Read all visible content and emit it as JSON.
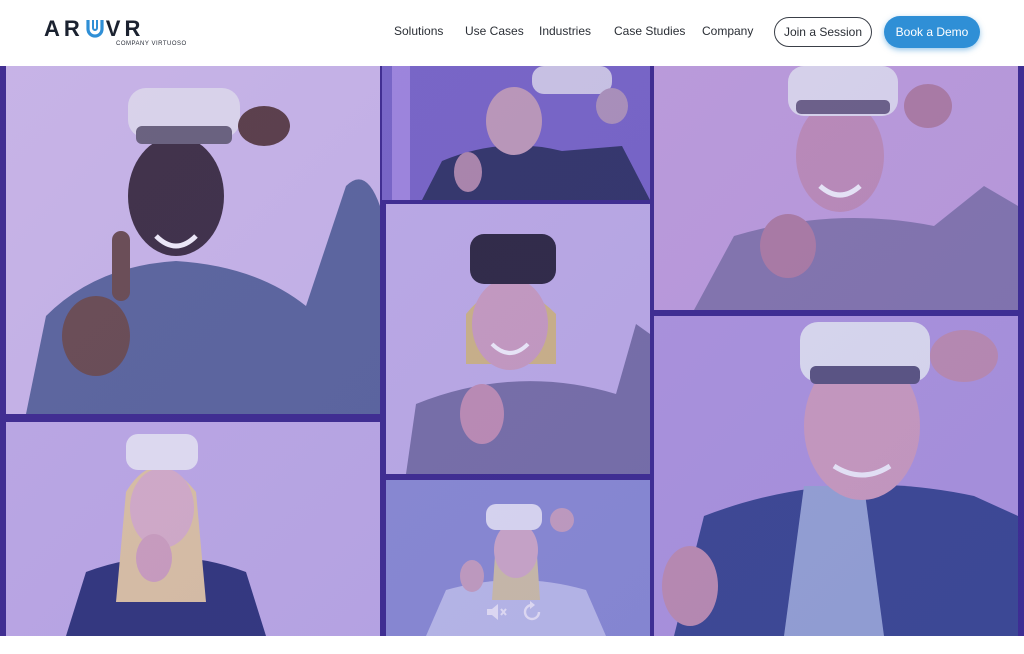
{
  "brand": {
    "logo_left": "AR",
    "logo_right": "VR",
    "logo_tagline": "COMPANY VIRTUOSO"
  },
  "nav": {
    "items": [
      {
        "label": "Solutions"
      },
      {
        "label": "Use Cases"
      },
      {
        "label": "Industries"
      },
      {
        "label": "Case Studies"
      },
      {
        "label": "Company"
      }
    ],
    "join_label": "Join a Session",
    "demo_label": "Book a Demo"
  },
  "colors": {
    "primary_button": "#2f8fd6",
    "hero_overlay": "#6b3fb5",
    "grid_border": "#3b2a8a"
  },
  "hero": {
    "tiles": [
      {
        "name": "man-in-blue-sweater-thumbs-up"
      },
      {
        "name": "bald-man-in-suit-thumbs-up"
      },
      {
        "name": "smiling-man-thumbs-up"
      },
      {
        "name": "woman-in-grey-sweater-thumbs-up"
      },
      {
        "name": "older-man-in-blazer-thumbs-up"
      },
      {
        "name": "blonde-woman-in-navy-blazer-thumbs-up"
      },
      {
        "name": "woman-in-white-shirt-thumbs-up"
      }
    ],
    "video_controls": [
      "mute-icon",
      "replay-icon"
    ]
  }
}
